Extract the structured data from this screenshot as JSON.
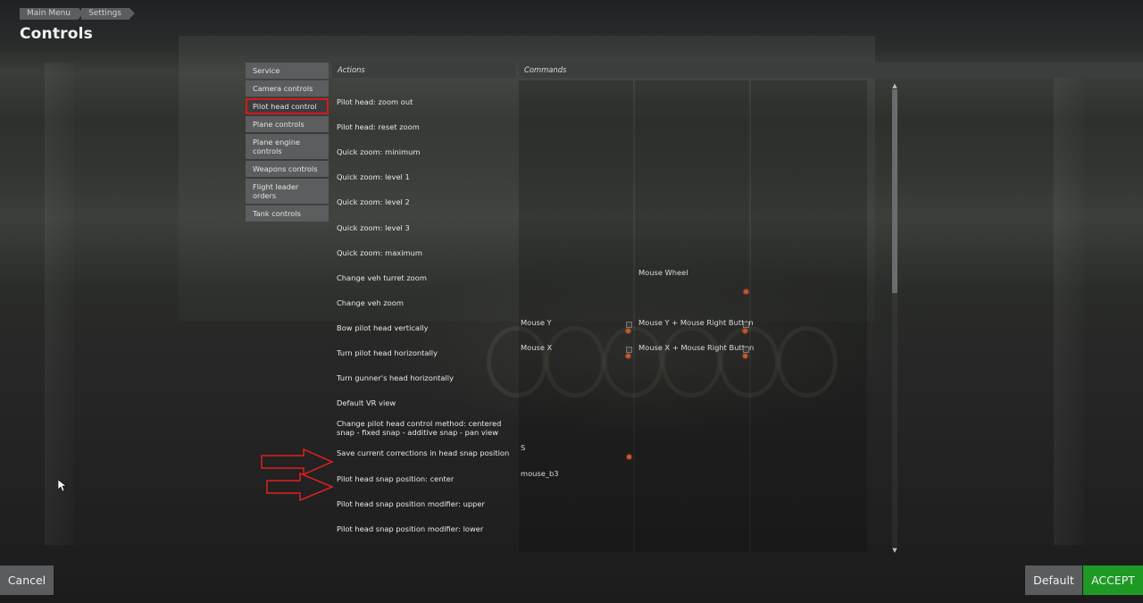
{
  "breadcrumb": [
    "Main Menu",
    "Settings"
  ],
  "page_title": "Controls",
  "categories": [
    {
      "label": "Service"
    },
    {
      "label": "Camera controls"
    },
    {
      "label": "Pilot head control",
      "selected": true
    },
    {
      "label": "Plane controls"
    },
    {
      "label": "Plane engine controls"
    },
    {
      "label": "Weapons controls"
    },
    {
      "label": "Flight leader orders"
    },
    {
      "label": "Tank controls"
    }
  ],
  "headers": {
    "actions": "Actions",
    "commands": "Commands"
  },
  "rows": [
    {
      "action": "Pilot head: zoom out",
      "cmd1": "",
      "cmd2": ""
    },
    {
      "action": "Pilot head: reset zoom",
      "cmd1": "",
      "cmd2": ""
    },
    {
      "action": "Quick zoom: minimum",
      "cmd1": "",
      "cmd2": ""
    },
    {
      "action": "Quick zoom: level 1",
      "cmd1": "",
      "cmd2": ""
    },
    {
      "action": "Quick zoom: level 2",
      "cmd1": "",
      "cmd2": ""
    },
    {
      "action": "Quick zoom: level 3",
      "cmd1": "",
      "cmd2": ""
    },
    {
      "action": "Quick zoom: maximum",
      "cmd1": "",
      "cmd2": ""
    },
    {
      "action": "Change veh turret zoom",
      "cmd1": "",
      "cmd2": "Mouse Wheel"
    },
    {
      "action": "Change veh zoom",
      "cmd1": "",
      "cmd2": ""
    },
    {
      "action": "Bow pilot head vertically",
      "cmd1": "Mouse Y",
      "cmd2": "Mouse Y + Mouse Right Button"
    },
    {
      "action": "Turn pilot head horizontally",
      "cmd1": "Mouse X",
      "cmd2": "Mouse X + Mouse Right Button"
    },
    {
      "action": "Turn gunner's head horizontally",
      "cmd1": "",
      "cmd2": ""
    },
    {
      "action": "Default VR view",
      "cmd1": "",
      "cmd2": ""
    },
    {
      "action": "Change pilot head control method: centered snap - fixed snap - additive snap - pan view",
      "cmd1": "",
      "cmd2": ""
    },
    {
      "action": "Save current corrections in head snap position",
      "cmd1": "S",
      "cmd2": ""
    },
    {
      "action": "Pilot head snap position: center",
      "cmd1": "mouse_b3",
      "cmd2": ""
    },
    {
      "action": "Pilot head snap position modifier: upper",
      "cmd1": "",
      "cmd2": ""
    },
    {
      "action": "Pilot head snap position modifier: lower",
      "cmd1": "",
      "cmd2": ""
    }
  ],
  "buttons": {
    "cancel": "Cancel",
    "default": "Default",
    "accept": "ACCEPT"
  },
  "colors": {
    "accent": "#1e9a24",
    "highlight": "#d11a1a",
    "panel": "#5b5d5f"
  }
}
